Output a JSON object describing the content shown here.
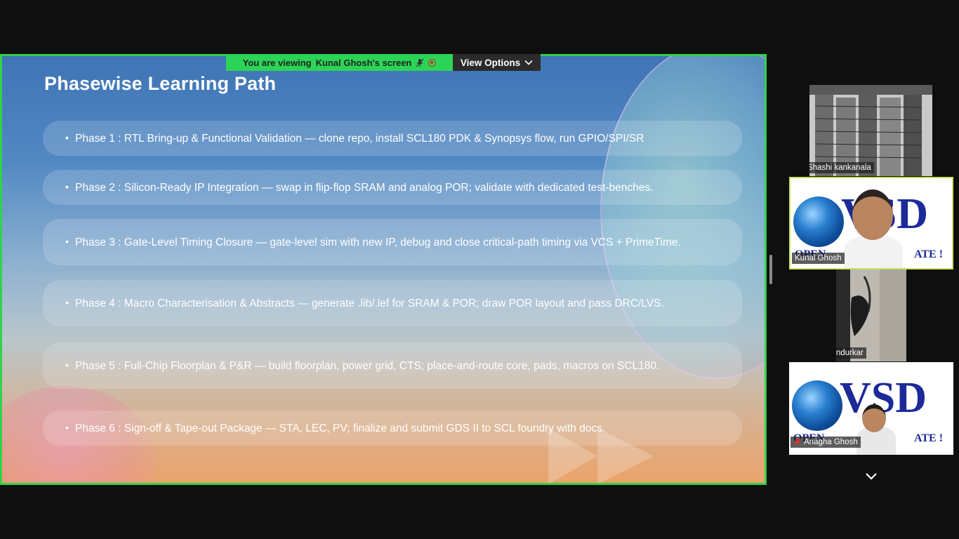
{
  "banner": {
    "viewing_label": "You are viewing",
    "presenter": "Kunal Ghosh's screen",
    "view_options": "View Options"
  },
  "slide": {
    "title": "Phasewise Learning Path",
    "phases": [
      "Phase 1 : RTL Bring-up & Functional Validation — clone repo, install SCL180 PDK & Synopsys flow, run GPIO/SPI/SR",
      "Phase 2 : Silicon-Ready IP Integration — swap in flip-flop SRAM and analog POR; validate with dedicated test-benches.",
      "Phase 3 : Gate-Level Timing Closure — gate-level sim with new IP, debug and close critical-path timing via VCS + PrimeTime.",
      "Phase 4 : Macro Characterisation & Abstracts — generate .lib/.lef for SRAM & POR; draw POR layout and pass DRC/LVS.",
      "Phase 5 : Full-Chip Floorplan & P&R — build floorplan, power grid, CTS; place-and-route core, pads, macros on SCL180.",
      "Phase 6 : Sign-off & Tape-out Package — STA, LEC, PV; finalize and submit GDS II to SCL foundry with docs."
    ]
  },
  "participants": [
    {
      "name": "Shashi kankanala",
      "muted": true
    },
    {
      "name": "Kunal Ghosh",
      "muted": false,
      "active_speaker": true
    },
    {
      "name": "Pranav Indurkar",
      "muted": true
    },
    {
      "name": "Anagha Ghosh",
      "muted": true
    }
  ],
  "vsd_logo": {
    "letters": "VSD",
    "tagline_left": "OPEN",
    "tagline_right": "ATE !",
    "tagline_right_2": "ATE !"
  },
  "colors": {
    "share_border": "#2fd34a",
    "active_speaker_border": "#c8e35a",
    "banner_bg": "#2bd456",
    "muted_icon": "#e0312c"
  },
  "icons": {
    "mic_off": "mic-off-icon",
    "record": "record-icon",
    "chevron": "chevron-down-icon"
  }
}
